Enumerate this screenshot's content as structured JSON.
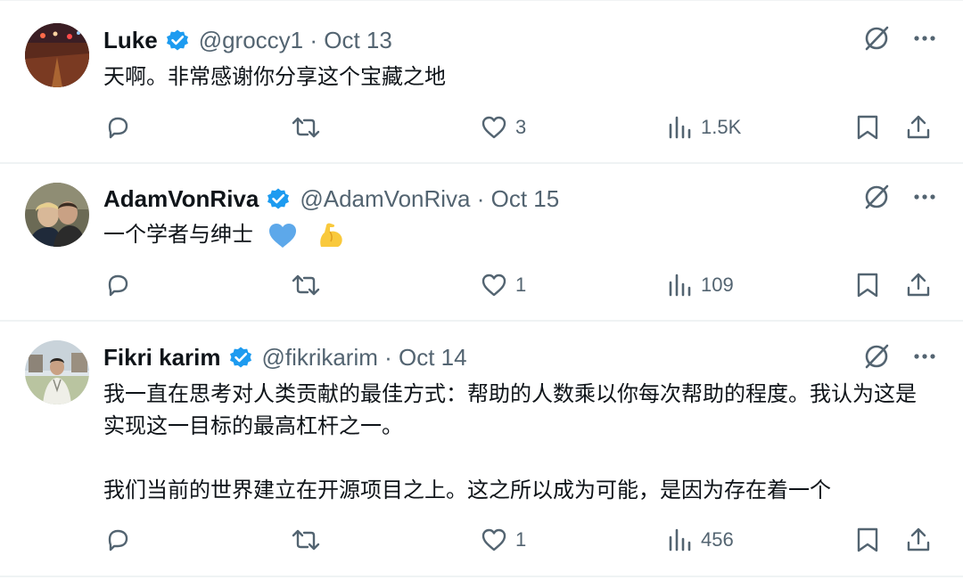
{
  "tweets": [
    {
      "name": "Luke",
      "meta": "@groccy1 · Oct 13",
      "text": [
        "天啊。非常感谢你分享这个宝藏之地"
      ],
      "likes": "3",
      "views": "1.5K"
    },
    {
      "name": "AdamVonRiva",
      "meta": "@AdamVonRiva · Oct 15",
      "text": [
        "一个学者与绅士"
      ],
      "emojis": [
        "blue-heart",
        "flexed-biceps"
      ],
      "likes": "1",
      "views": "109"
    },
    {
      "name": "Fikri karim",
      "meta": "@fikrikarim · Oct 14",
      "text": [
        "我一直在思考对人类贡献的最佳方式：帮助的人数乘以你每次帮助的程度。我认为这是实现这一目标的最高杠杆之一。",
        "我们当前的世界建立在开源项目之上。这之所以成为可能，是因为存在着一个"
      ],
      "likes": "1",
      "views": "456"
    }
  ],
  "colors": {
    "icon": "#536471",
    "verified": "#1d9bf0",
    "divider": "#eff3f4",
    "text": "#0f1419"
  }
}
